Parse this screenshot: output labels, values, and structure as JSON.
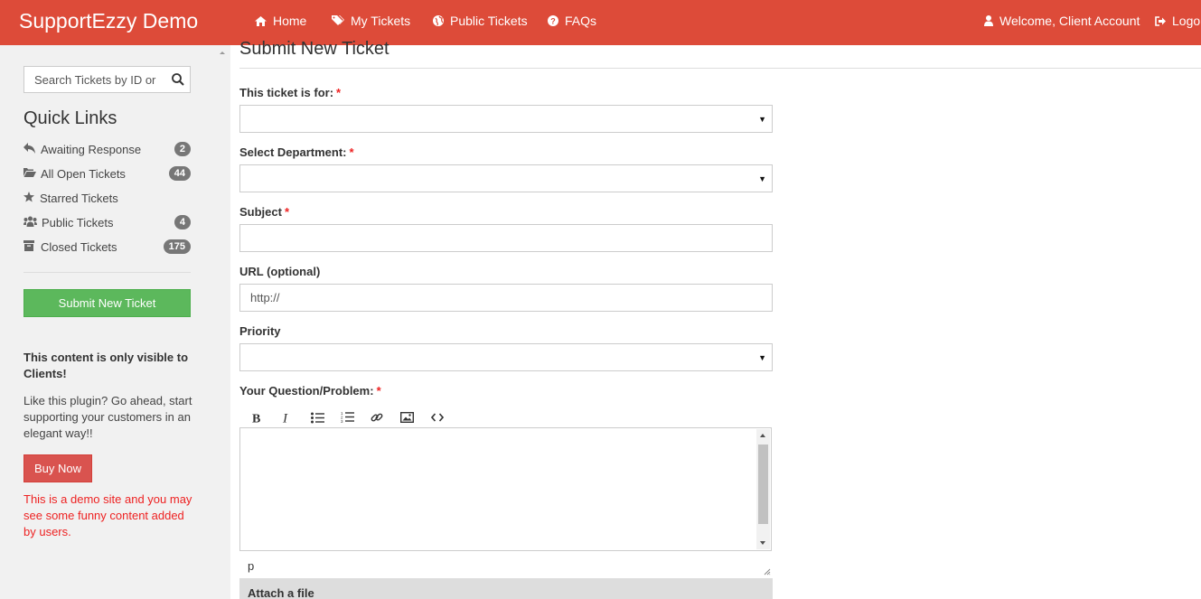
{
  "app": {
    "brand": "SupportEzzy Demo"
  },
  "nav": {
    "items": [
      {
        "label": "Home",
        "icon": "home-icon"
      },
      {
        "label": "My Tickets",
        "icon": "tags-icon"
      },
      {
        "label": "Public Tickets",
        "icon": "globe-icon"
      },
      {
        "label": "FAQs",
        "icon": "question-circle-icon"
      }
    ],
    "welcome": "Welcome, Client Account",
    "logout": "Logou"
  },
  "sidebar": {
    "search_placeholder": "Search Tickets by ID or",
    "quick_links_title": "Quick Links",
    "quick_links": [
      {
        "label": "Awaiting Response",
        "icon": "reply-icon",
        "count": "2"
      },
      {
        "label": "All Open Tickets",
        "icon": "folder-open-icon",
        "count": "44"
      },
      {
        "label": "Starred Tickets",
        "icon": "star-icon",
        "count": ""
      },
      {
        "label": "Public Tickets",
        "icon": "users-icon",
        "count": "4"
      },
      {
        "label": "Closed Tickets",
        "icon": "archive-icon",
        "count": "175"
      }
    ],
    "submit_button": "Submit New Ticket",
    "client_note": "This content is only visible to Clients!",
    "promo": "Like this plugin? Go ahead, start supporting your customers in an elegant way!!",
    "buy_button": "Buy Now",
    "demo_note": "This is a demo site and you may see some funny content added by users."
  },
  "form": {
    "title": "Submit New Ticket",
    "ticket_for_label": "This ticket is for:",
    "department_label": "Select Department:",
    "subject_label": "Subject",
    "url_label": "URL (optional)",
    "url_value": "http://",
    "priority_label": "Priority",
    "question_label": "Your Question/Problem:",
    "required_mark": "*",
    "editor_path": "p",
    "attach_label": "Attach a file"
  },
  "colors": {
    "brand": "#dd4b39",
    "success": "#5cb85c",
    "danger": "#d9534f",
    "badge": "#777777",
    "sidebar_bg": "#f1f1f1"
  }
}
